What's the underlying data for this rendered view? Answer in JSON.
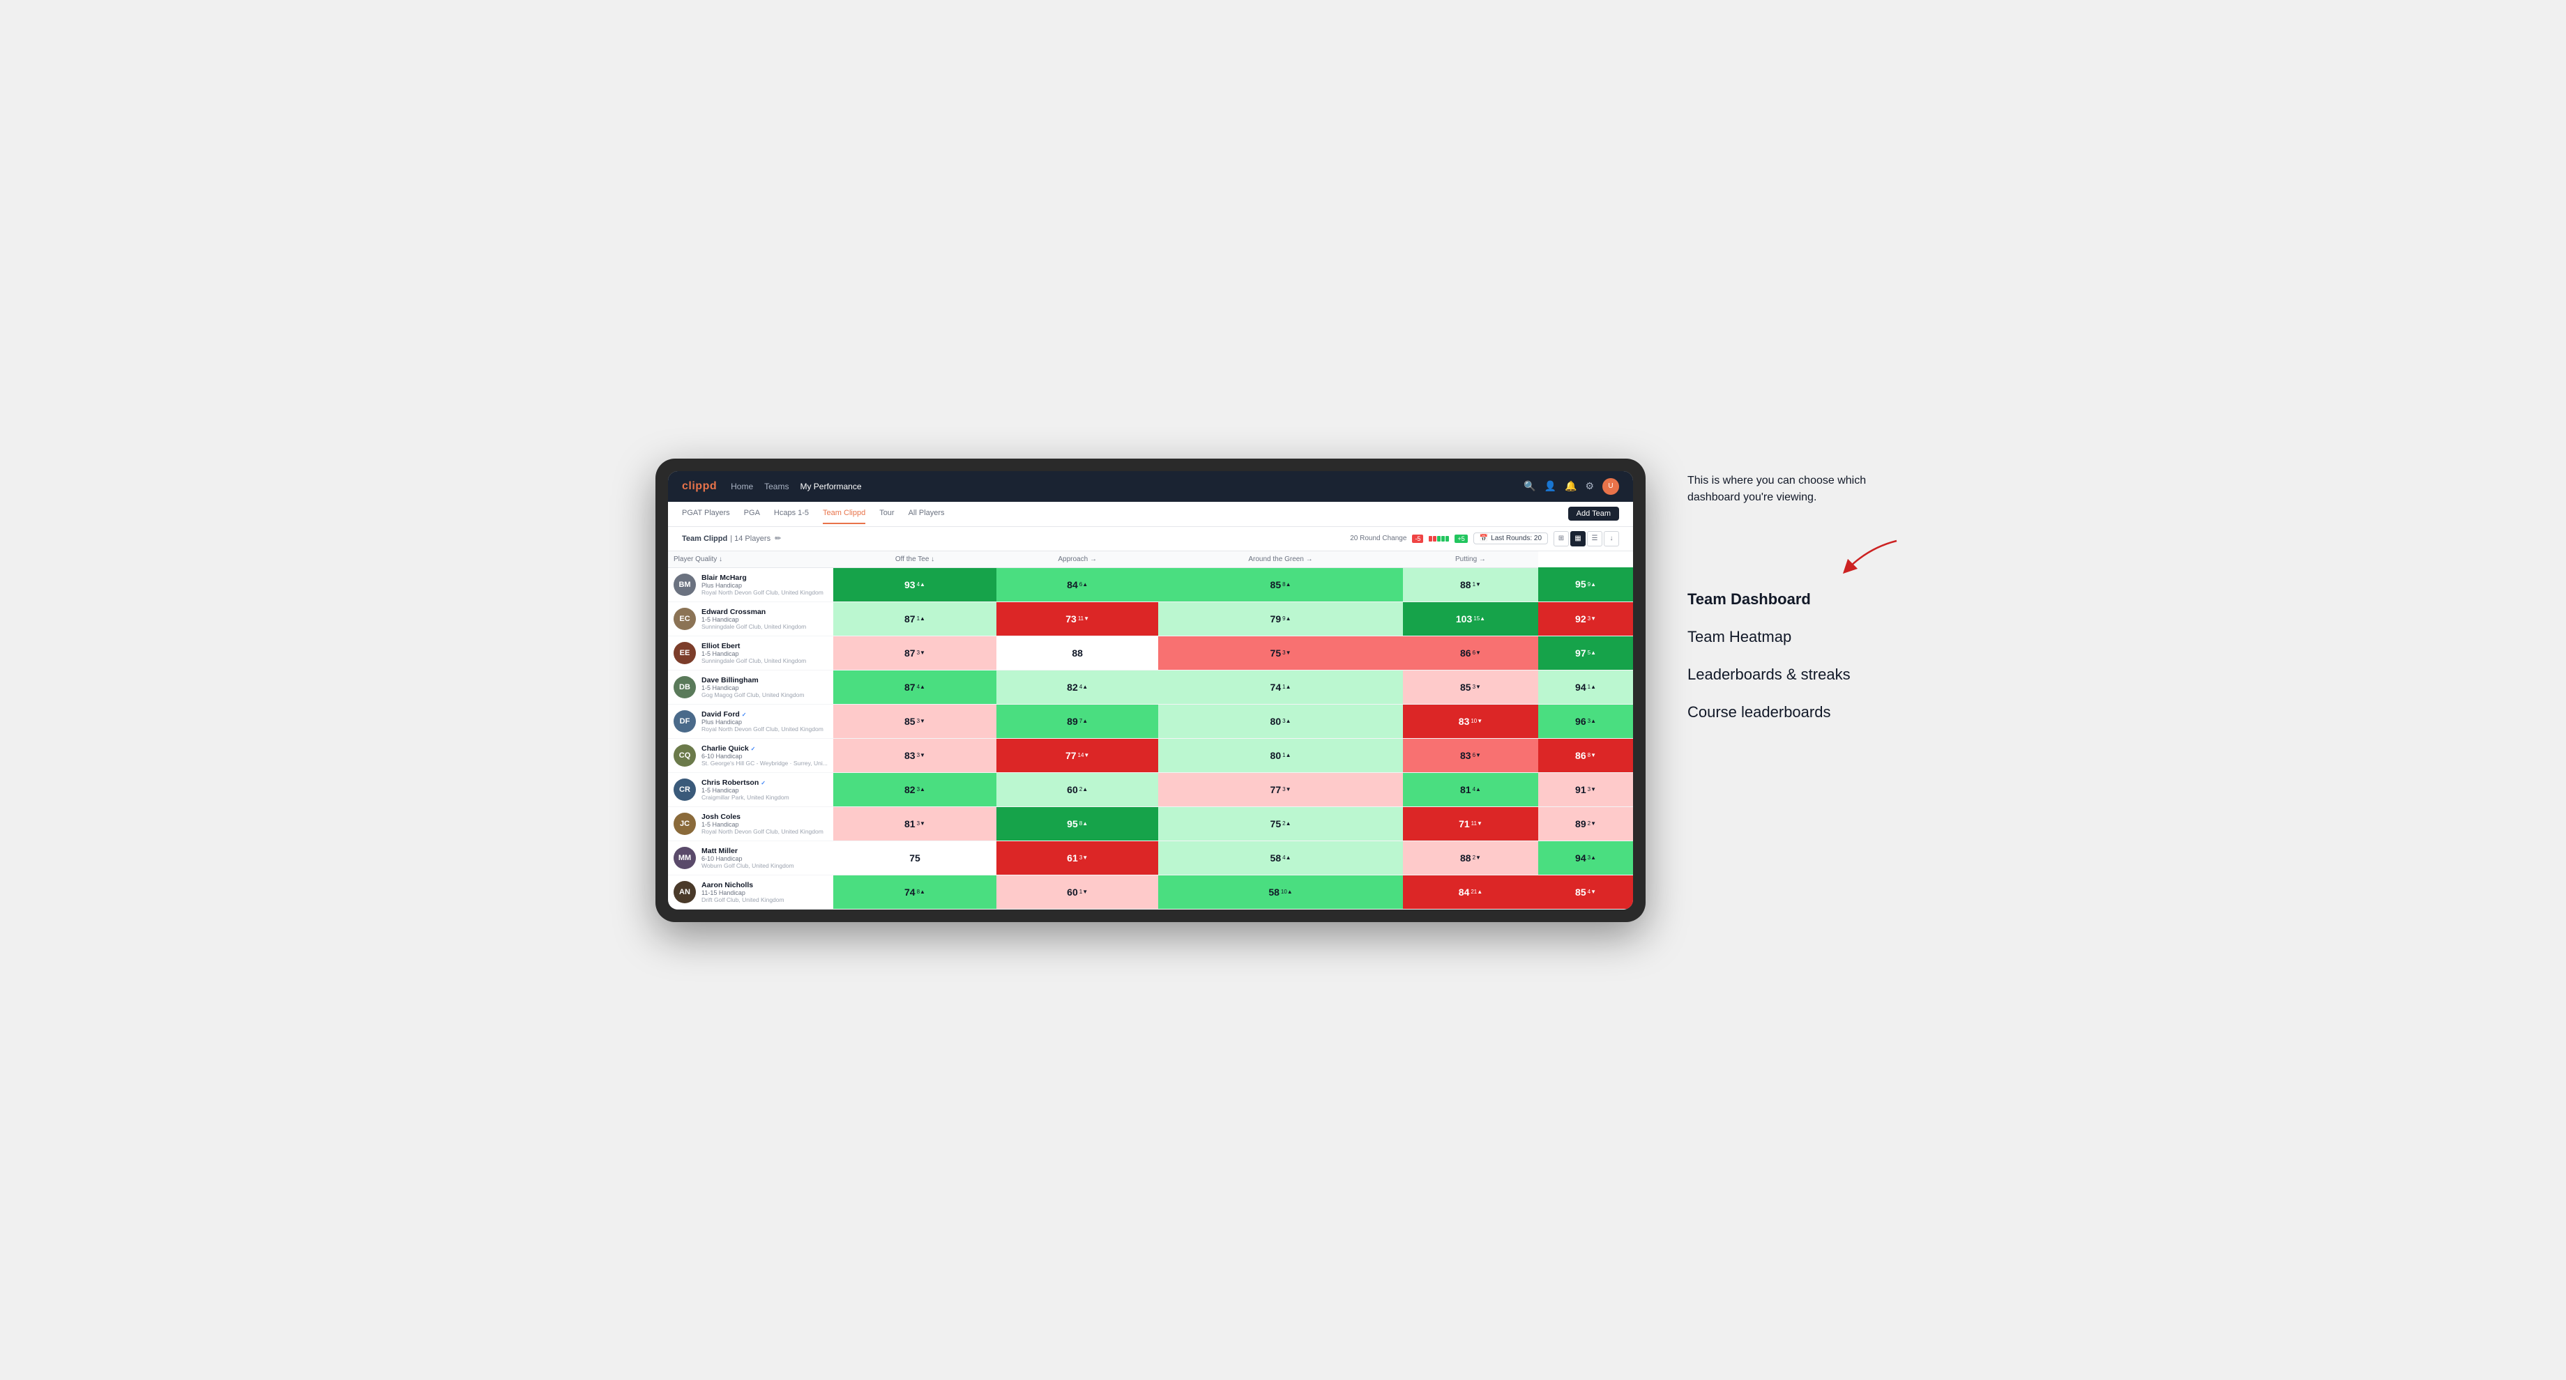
{
  "annotation": {
    "intro_text": "This is where you can choose which dashboard you're viewing.",
    "menu_items": [
      {
        "label": "Team Dashboard",
        "active": true
      },
      {
        "label": "Team Heatmap",
        "active": false
      },
      {
        "label": "Leaderboards & streaks",
        "active": false
      },
      {
        "label": "Course leaderboards",
        "active": false
      }
    ]
  },
  "nav": {
    "logo": "clippd",
    "links": [
      {
        "label": "Home",
        "active": false
      },
      {
        "label": "Teams",
        "active": false
      },
      {
        "label": "My Performance",
        "active": false
      }
    ],
    "icons": [
      "search",
      "user",
      "bell",
      "settings",
      "avatar"
    ]
  },
  "sub_nav": {
    "links": [
      {
        "label": "PGAT Players",
        "active": false
      },
      {
        "label": "PGA",
        "active": false
      },
      {
        "label": "Hcaps 1-5",
        "active": false
      },
      {
        "label": "Team Clippd",
        "active": true
      },
      {
        "label": "Tour",
        "active": false
      },
      {
        "label": "All Players",
        "active": false
      }
    ],
    "add_team_label": "Add Team"
  },
  "team_header": {
    "name": "Team Clippd",
    "separator": "|",
    "player_count": "14 Players",
    "round_change_label": "20 Round Change",
    "change_negative": "-5",
    "change_positive": "+5",
    "last_rounds_label": "Last Rounds:",
    "last_rounds_value": "20"
  },
  "table": {
    "column_headers": [
      {
        "label": "Player Quality ↓",
        "key": "player_quality"
      },
      {
        "label": "Off the Tee ↓",
        "key": "off_the_tee"
      },
      {
        "label": "Approach →",
        "key": "approach"
      },
      {
        "label": "Around the Green →",
        "key": "around_green"
      },
      {
        "label": "Putting →",
        "key": "putting"
      }
    ],
    "rows": [
      {
        "name": "Blair McHarg",
        "handicap": "Plus Handicap",
        "club": "Royal North Devon Golf Club, United Kingdom",
        "initials": "BM",
        "avatar_color": "#6b7280",
        "scores": [
          {
            "value": 93,
            "change": 4,
            "direction": "up",
            "heat": "heat-strong-green"
          },
          {
            "value": 84,
            "change": 6,
            "direction": "up",
            "heat": "heat-green"
          },
          {
            "value": 85,
            "change": 8,
            "direction": "up",
            "heat": "heat-green"
          },
          {
            "value": 88,
            "change": 1,
            "direction": "down",
            "heat": "heat-light-green"
          },
          {
            "value": 95,
            "change": 9,
            "direction": "up",
            "heat": "heat-strong-green"
          }
        ]
      },
      {
        "name": "Edward Crossman",
        "handicap": "1-5 Handicap",
        "club": "Sunningdale Golf Club, United Kingdom",
        "initials": "EC",
        "avatar_color": "#8b7355",
        "scores": [
          {
            "value": 87,
            "change": 1,
            "direction": "up",
            "heat": "heat-light-green"
          },
          {
            "value": 73,
            "change": 11,
            "direction": "down",
            "heat": "heat-strong-red"
          },
          {
            "value": 79,
            "change": 9,
            "direction": "up",
            "heat": "heat-light-green"
          },
          {
            "value": 103,
            "change": 15,
            "direction": "up",
            "heat": "heat-strong-green"
          },
          {
            "value": 92,
            "change": 3,
            "direction": "down",
            "heat": "heat-strong-red"
          }
        ]
      },
      {
        "name": "Elliot Ebert",
        "handicap": "1-5 Handicap",
        "club": "Sunningdale Golf Club, United Kingdom",
        "initials": "EE",
        "avatar_color": "#7c3d2a",
        "scores": [
          {
            "value": 87,
            "change": 3,
            "direction": "down",
            "heat": "heat-light-red"
          },
          {
            "value": 88,
            "change": null,
            "direction": null,
            "heat": "heat-neutral"
          },
          {
            "value": 75,
            "change": 3,
            "direction": "down",
            "heat": "heat-red"
          },
          {
            "value": 86,
            "change": 6,
            "direction": "down",
            "heat": "heat-red"
          },
          {
            "value": 97,
            "change": 5,
            "direction": "up",
            "heat": "heat-strong-green"
          }
        ]
      },
      {
        "name": "Dave Billingham",
        "handicap": "1-5 Handicap",
        "club": "Gog Magog Golf Club, United Kingdom",
        "initials": "DB",
        "avatar_color": "#5a7a5a",
        "scores": [
          {
            "value": 87,
            "change": 4,
            "direction": "up",
            "heat": "heat-green"
          },
          {
            "value": 82,
            "change": 4,
            "direction": "up",
            "heat": "heat-light-green"
          },
          {
            "value": 74,
            "change": 1,
            "direction": "up",
            "heat": "heat-light-green"
          },
          {
            "value": 85,
            "change": 3,
            "direction": "down",
            "heat": "heat-light-red"
          },
          {
            "value": 94,
            "change": 1,
            "direction": "up",
            "heat": "heat-light-green"
          }
        ]
      },
      {
        "name": "David Ford",
        "handicap": "Plus Handicap",
        "club": "Royal North Devon Golf Club, United Kingdom",
        "initials": "DF",
        "avatar_color": "#4a6a8a",
        "verified": true,
        "scores": [
          {
            "value": 85,
            "change": 3,
            "direction": "down",
            "heat": "heat-light-red"
          },
          {
            "value": 89,
            "change": 7,
            "direction": "up",
            "heat": "heat-green"
          },
          {
            "value": 80,
            "change": 3,
            "direction": "up",
            "heat": "heat-light-green"
          },
          {
            "value": 83,
            "change": 10,
            "direction": "down",
            "heat": "heat-strong-red"
          },
          {
            "value": 96,
            "change": 3,
            "direction": "up",
            "heat": "heat-green"
          }
        ]
      },
      {
        "name": "Charlie Quick",
        "handicap": "6-10 Handicap",
        "club": "St. George's Hill GC - Weybridge · Surrey, Uni...",
        "initials": "CQ",
        "avatar_color": "#6b7a4a",
        "verified": true,
        "scores": [
          {
            "value": 83,
            "change": 3,
            "direction": "down",
            "heat": "heat-light-red"
          },
          {
            "value": 77,
            "change": 14,
            "direction": "down",
            "heat": "heat-strong-red"
          },
          {
            "value": 80,
            "change": 1,
            "direction": "up",
            "heat": "heat-light-green"
          },
          {
            "value": 83,
            "change": 6,
            "direction": "down",
            "heat": "heat-red"
          },
          {
            "value": 86,
            "change": 8,
            "direction": "down",
            "heat": "heat-strong-red"
          }
        ]
      },
      {
        "name": "Chris Robertson",
        "handicap": "1-5 Handicap",
        "club": "Craigmillar Park, United Kingdom",
        "initials": "CR",
        "avatar_color": "#3a5a7a",
        "verified": true,
        "scores": [
          {
            "value": 82,
            "change": 3,
            "direction": "up",
            "heat": "heat-green"
          },
          {
            "value": 60,
            "change": 2,
            "direction": "up",
            "heat": "heat-light-green"
          },
          {
            "value": 77,
            "change": 3,
            "direction": "down",
            "heat": "heat-light-red"
          },
          {
            "value": 81,
            "change": 4,
            "direction": "up",
            "heat": "heat-green"
          },
          {
            "value": 91,
            "change": 3,
            "direction": "down",
            "heat": "heat-light-red"
          }
        ]
      },
      {
        "name": "Josh Coles",
        "handicap": "1-5 Handicap",
        "club": "Royal North Devon Golf Club, United Kingdom",
        "initials": "JC",
        "avatar_color": "#8a6a3a",
        "scores": [
          {
            "value": 81,
            "change": 3,
            "direction": "down",
            "heat": "heat-light-red"
          },
          {
            "value": 95,
            "change": 8,
            "direction": "up",
            "heat": "heat-strong-green"
          },
          {
            "value": 75,
            "change": 2,
            "direction": "up",
            "heat": "heat-light-green"
          },
          {
            "value": 71,
            "change": 11,
            "direction": "down",
            "heat": "heat-strong-red"
          },
          {
            "value": 89,
            "change": 2,
            "direction": "down",
            "heat": "heat-light-red"
          }
        ]
      },
      {
        "name": "Matt Miller",
        "handicap": "6-10 Handicap",
        "club": "Woburn Golf Club, United Kingdom",
        "initials": "MM",
        "avatar_color": "#5a4a6a",
        "scores": [
          {
            "value": 75,
            "change": null,
            "direction": null,
            "heat": "heat-neutral"
          },
          {
            "value": 61,
            "change": 3,
            "direction": "down",
            "heat": "heat-strong-red"
          },
          {
            "value": 58,
            "change": 4,
            "direction": "up",
            "heat": "heat-light-green"
          },
          {
            "value": 88,
            "change": 2,
            "direction": "down",
            "heat": "heat-light-red"
          },
          {
            "value": 94,
            "change": 3,
            "direction": "up",
            "heat": "heat-green"
          }
        ]
      },
      {
        "name": "Aaron Nicholls",
        "handicap": "11-15 Handicap",
        "club": "Drift Golf Club, United Kingdom",
        "initials": "AN",
        "avatar_color": "#4a3a2a",
        "scores": [
          {
            "value": 74,
            "change": 8,
            "direction": "up",
            "heat": "heat-green"
          },
          {
            "value": 60,
            "change": 1,
            "direction": "down",
            "heat": "heat-light-red"
          },
          {
            "value": 58,
            "change": 10,
            "direction": "up",
            "heat": "heat-green"
          },
          {
            "value": 84,
            "change": 21,
            "direction": "up",
            "heat": "heat-strong-red"
          },
          {
            "value": 85,
            "change": 4,
            "direction": "down",
            "heat": "heat-strong-red"
          }
        ]
      }
    ]
  }
}
